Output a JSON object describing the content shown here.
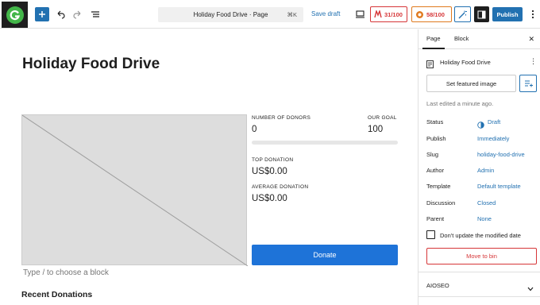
{
  "topbar": {
    "command_title": "Holiday Food Drive · Page",
    "command_shortcut": "⌘K",
    "save_draft": "Save draft",
    "seo_score": "31/100",
    "readability_score": "58/100",
    "publish": "Publish"
  },
  "editor": {
    "title": "Holiday Food Drive",
    "donors_label": "NUMBER OF DONORS",
    "donors_value": "0",
    "goal_label": "OUR GOAL",
    "goal_value": "100",
    "progress_fraction": 0,
    "top_donation_label": "TOP DONATION",
    "top_donation_value": "US$0.00",
    "avg_donation_label": "AVERAGE DONATION",
    "avg_donation_value": "US$0.00",
    "donate_button": "Donate",
    "type_hint": "Type / to choose a block",
    "recent_heading": "Recent Donations"
  },
  "sidebar": {
    "tab_page": "Page",
    "tab_block": "Block",
    "doc_title": "Holiday Food Drive",
    "featured_button": "Set featured image",
    "last_edited": "Last edited a minute ago.",
    "rows": {
      "status_label": "Status",
      "status_value": "Draft",
      "publish_label": "Publish",
      "publish_value": "Immediately",
      "slug_label": "Slug",
      "slug_value": "holiday-food-drive",
      "author_label": "Author",
      "author_value": "Admin",
      "template_label": "Template",
      "template_value": "Default template",
      "discussion_label": "Discussion",
      "discussion_value": "Closed",
      "parent_label": "Parent",
      "parent_value": "None"
    },
    "checkbox_label": "Don't update the modified date",
    "move_to_bin": "Move to bin",
    "aioseo": "AIOSEO"
  },
  "colors": {
    "accent": "#2271b1",
    "danger": "#d63638",
    "donate": "#1e73d8"
  }
}
